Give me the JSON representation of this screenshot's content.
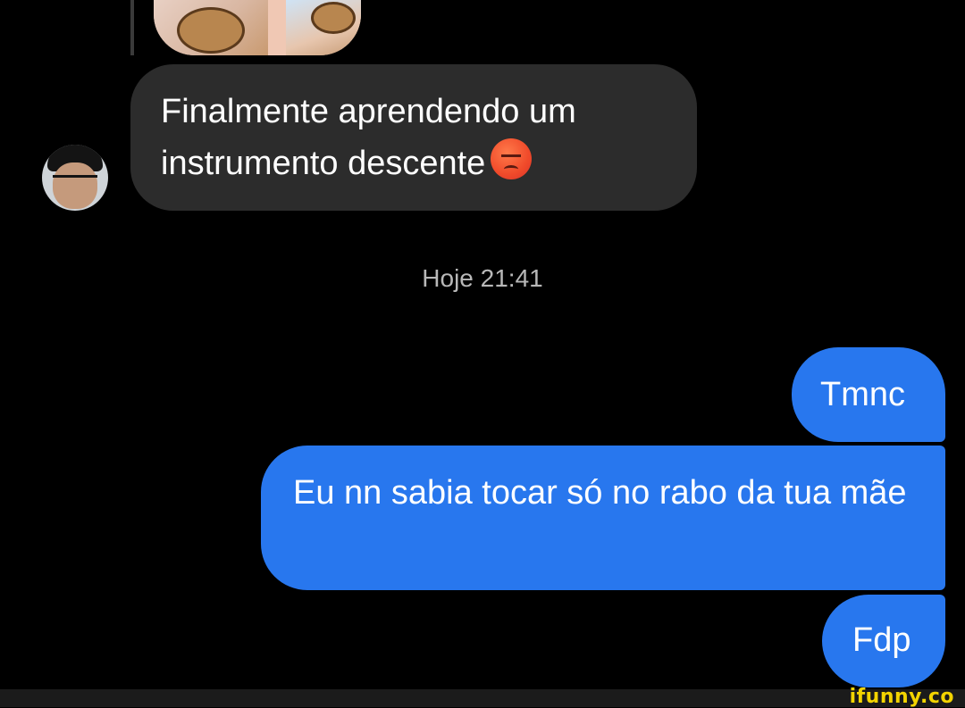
{
  "conversation": {
    "incoming_message": "Finalmente aprendendo um instrumento descente",
    "incoming_emoji": "angry-face-icon",
    "timestamp": "Hoje 21:41",
    "outgoing_messages": [
      "Tmnc",
      "Eu nn sabia tocar só no rabo da tua mãe",
      "Fdp"
    ]
  },
  "watermark": "ifunny.co",
  "colors": {
    "background": "#000000",
    "incoming_bubble": "#2c2c2c",
    "outgoing_bubble": "#2877ee",
    "timestamp_text": "#b8b8b8",
    "watermark": "#f3d400"
  }
}
